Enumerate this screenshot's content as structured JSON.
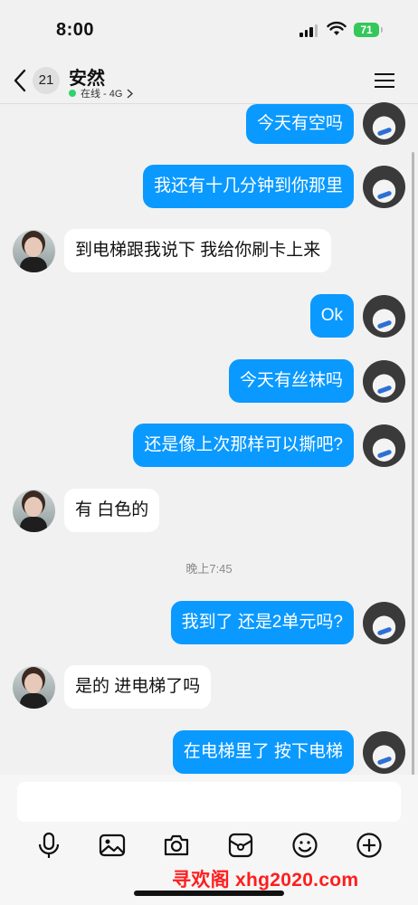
{
  "status_bar": {
    "time": "8:00",
    "battery": "71"
  },
  "header": {
    "unread_count": "21",
    "contact_name": "安然",
    "presence": "在线 - 4G"
  },
  "messages": [
    {
      "from": "me",
      "text": "今天有空吗"
    },
    {
      "from": "me",
      "text": "我还有十几分钟到你那里"
    },
    {
      "from": "her",
      "text": "到电梯跟我说下 我给你刷卡上来"
    },
    {
      "from": "me",
      "text": "Ok"
    },
    {
      "from": "me",
      "text": "今天有丝袜吗"
    },
    {
      "from": "me",
      "text": "还是像上次那样可以撕吧?"
    },
    {
      "from": "her",
      "text": "有 白色的"
    },
    {
      "from": "me",
      "text": "我到了 还是2单元吗?"
    },
    {
      "from": "her",
      "text": "是的 进电梯了吗"
    },
    {
      "from": "me",
      "text": "在电梯里了 按下电梯"
    }
  ],
  "timestamp": "晚上7:45",
  "composer": {
    "input_value": ""
  },
  "toolbar_icons": [
    "microphone-icon",
    "image-icon",
    "camera-icon",
    "red-packet-icon",
    "emoji-icon",
    "plus-icon"
  ],
  "watermark": "寻欢阁 xhg2020.com",
  "colors": {
    "outgoing_bubble": "#0a99ff",
    "incoming_bubble": "#ffffff",
    "online_dot": "#2fd36b",
    "watermark": "#ff1d1d"
  }
}
